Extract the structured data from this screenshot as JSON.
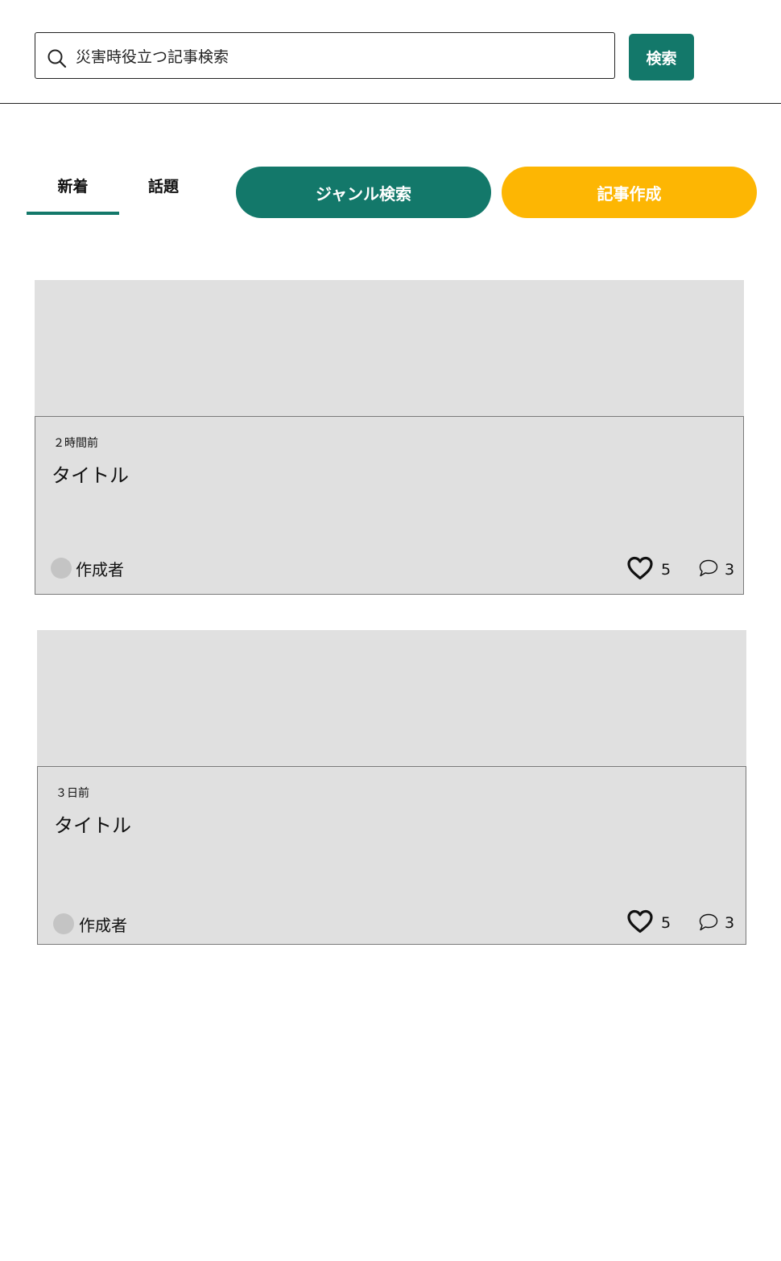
{
  "search": {
    "value": "災害時役立つ記事検索",
    "button_label": "検索"
  },
  "tabs": [
    {
      "label": "新着",
      "active": true
    },
    {
      "label": "話題",
      "active": false
    }
  ],
  "actions": {
    "genre_search_label": "ジャンル検索",
    "create_article_label": "記事作成"
  },
  "articles": [
    {
      "time": "２時間前",
      "title": "タイトル",
      "author": "作成者",
      "likes": "5",
      "comments": "3"
    },
    {
      "time": "３日前",
      "title": "タイトル",
      "author": "作成者",
      "likes": "5",
      "comments": "3"
    }
  ],
  "colors": {
    "primary_green": "#13786a",
    "accent_yellow": "#fdb603",
    "card_background": "#e0e0e0",
    "avatar_placeholder": "#c4c4c4"
  },
  "icons": {
    "search": "search-icon",
    "like": "heart-icon",
    "comment": "comment-icon"
  }
}
